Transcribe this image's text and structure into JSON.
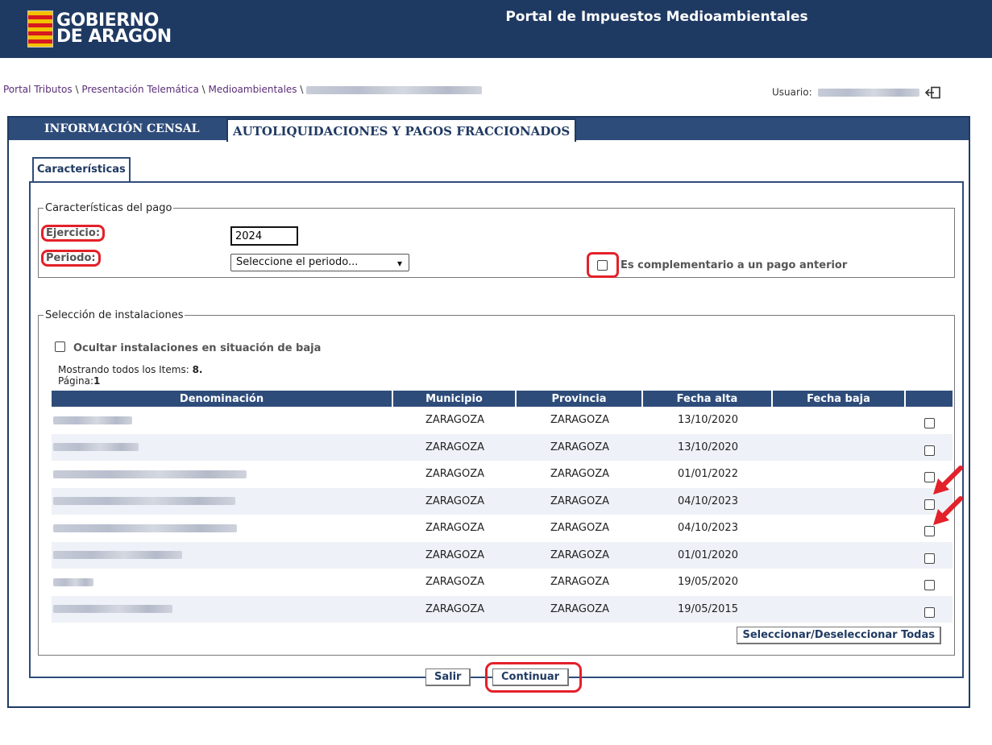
{
  "header": {
    "logo_line1": "GOBIERNO",
    "logo_line2": "DE ARAGON",
    "portal_title": "Portal de Impuestos Medioambientales"
  },
  "breadcrumb": {
    "items": [
      "Portal Tributos",
      "Presentación Telemática",
      "Medioambientales"
    ],
    "separator": " \\ "
  },
  "user": {
    "label": "Usuario:"
  },
  "tabs": {
    "inactive": "INFORMACIÓN CENSAL",
    "active": "AUTOLIQUIDACIONES Y PAGOS FRACCIONADOS"
  },
  "subtab": "Características",
  "pago": {
    "legend": "Características del pago",
    "ejercicio_label": "Ejercicio:",
    "ejercicio_value": "2024",
    "periodo_label": "Periodo:",
    "periodo_value": "Seleccione el periodo...",
    "complementario_label": "Es complementario a un pago anterior"
  },
  "instalaciones": {
    "legend": "Selección de instalaciones",
    "ocultar_label": "Ocultar instalaciones en situación de baja",
    "mostrando_label": "Mostrando todos los Items:",
    "mostrando_count": "8.",
    "pagina_label": "Página:",
    "pagina_value": "1",
    "columns": [
      "Denominación",
      "Municipio",
      "Provincia",
      "Fecha alta",
      "Fecha baja",
      ""
    ],
    "rows": [
      {
        "municipio": "ZARAGOZA",
        "provincia": "ZARAGOZA",
        "fecha_alta": "13/10/2020",
        "fecha_baja": ""
      },
      {
        "municipio": "ZARAGOZA",
        "provincia": "ZARAGOZA",
        "fecha_alta": "13/10/2020",
        "fecha_baja": ""
      },
      {
        "municipio": "ZARAGOZA",
        "provincia": "ZARAGOZA",
        "fecha_alta": "01/01/2022",
        "fecha_baja": ""
      },
      {
        "municipio": "ZARAGOZA",
        "provincia": "ZARAGOZA",
        "fecha_alta": "04/10/2023",
        "fecha_baja": ""
      },
      {
        "municipio": "ZARAGOZA",
        "provincia": "ZARAGOZA",
        "fecha_alta": "04/10/2023",
        "fecha_baja": ""
      },
      {
        "municipio": "ZARAGOZA",
        "provincia": "ZARAGOZA",
        "fecha_alta": "01/01/2020",
        "fecha_baja": ""
      },
      {
        "municipio": "ZARAGOZA",
        "provincia": "ZARAGOZA",
        "fecha_alta": "19/05/2020",
        "fecha_baja": ""
      },
      {
        "municipio": "ZARAGOZA",
        "provincia": "ZARAGOZA",
        "fecha_alta": "19/05/2015",
        "fecha_baja": ""
      }
    ],
    "select_all_label": "Seleccionar/Deseleccionar Todas"
  },
  "buttons": {
    "salir": "Salir",
    "continuar": "Continuar"
  },
  "colors": {
    "header_bg": "#1f3a62",
    "tab_bg": "#2e4c7a",
    "highlight": "#e3212a",
    "link": "#5a2d77"
  }
}
